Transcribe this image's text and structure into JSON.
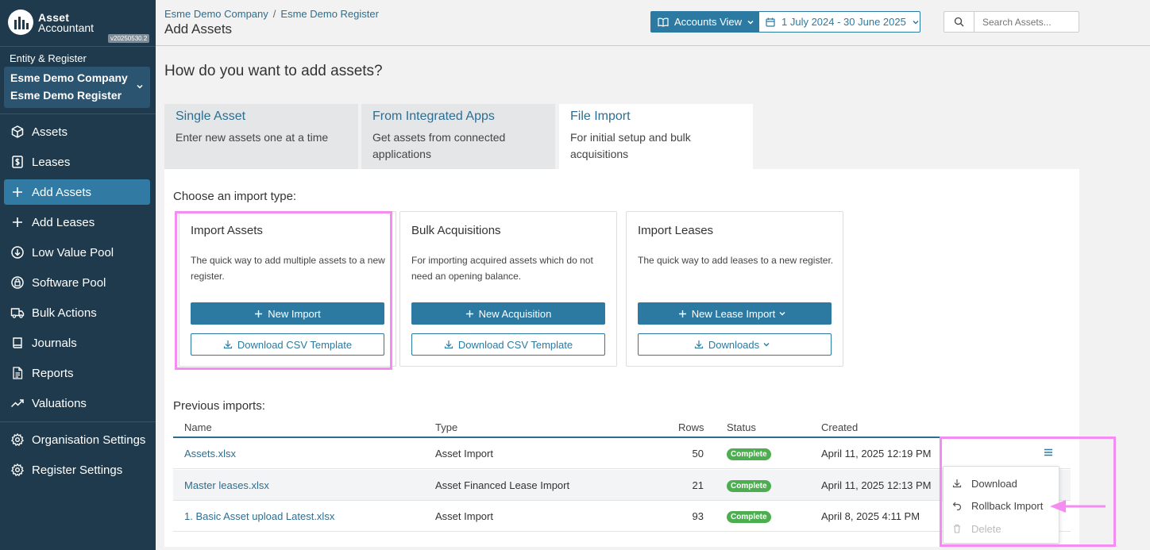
{
  "app": {
    "name_line1": "Asset",
    "name_line2": "Accountant",
    "version": "v20250530.2"
  },
  "sidebar": {
    "entity_label": "Entity & Register",
    "company": "Esme Demo Company",
    "register": "Esme Demo Register",
    "items": [
      {
        "label": "Assets",
        "icon": "cube-icon"
      },
      {
        "label": "Leases",
        "icon": "dollar-doc-icon"
      },
      {
        "label": "Add Assets",
        "icon": "plus-icon",
        "active": true
      },
      {
        "label": "Add Leases",
        "icon": "plus-icon"
      },
      {
        "label": "Low Value Pool",
        "icon": "arrow-circle-icon"
      },
      {
        "label": "Software Pool",
        "icon": "software-icon"
      },
      {
        "label": "Bulk Actions",
        "icon": "truck-icon"
      },
      {
        "label": "Journals",
        "icon": "book-icon"
      },
      {
        "label": "Reports",
        "icon": "report-icon"
      },
      {
        "label": "Valuations",
        "icon": "trend-icon"
      },
      {
        "label": "Organisation Settings",
        "icon": "gear-icon"
      },
      {
        "label": "Register Settings",
        "icon": "gear-icon"
      }
    ]
  },
  "header": {
    "breadcrumb": [
      "Esme Demo Company",
      "Esme Demo Register"
    ],
    "title": "Add Assets",
    "view_label": "Accounts View",
    "date_range": "1 July 2024 - 30 June 2025",
    "search_placeholder": "Search Assets..."
  },
  "main": {
    "question": "How do you want to add assets?",
    "tabs": [
      {
        "title": "Single Asset",
        "desc": "Enter new assets one at a time"
      },
      {
        "title": "From Integrated Apps",
        "desc": "Get assets from connected applications"
      },
      {
        "title": "File Import",
        "desc": "For initial setup and bulk acquisitions",
        "active": true
      }
    ],
    "choose_label": "Choose an import type:",
    "cards": [
      {
        "title": "Import Assets",
        "desc": "The quick way to add multiple assets to a new register.",
        "primary": "New Import",
        "secondary": "Download CSV Template"
      },
      {
        "title": "Bulk Acquisitions",
        "desc": "For importing acquired assets which do not need an opening balance.",
        "primary": "New Acquisition",
        "secondary": "Download CSV Template"
      },
      {
        "title": "Import Leases",
        "desc": "The quick way to add leases to a new register.",
        "primary": "New Lease Import",
        "secondary": "Downloads"
      }
    ],
    "previous_label": "Previous imports:",
    "columns": {
      "name": "Name",
      "type": "Type",
      "rows": "Rows",
      "status": "Status",
      "created": "Created"
    },
    "imports": [
      {
        "name": "Assets.xlsx",
        "type": "Asset Import",
        "rows": "50",
        "status": "Complete",
        "created": "April 11, 2025 12:19 PM"
      },
      {
        "name": "Master leases.xlsx",
        "type": "Asset Financed Lease Import",
        "rows": "21",
        "status": "Complete",
        "created": "April 11, 2025 12:13 PM"
      },
      {
        "name": "1. Basic Asset upload Latest.xlsx",
        "type": "Asset Import",
        "rows": "93",
        "status": "Complete",
        "created": "April 8, 2025 4:11 PM"
      }
    ],
    "row_menu": [
      {
        "label": "Download",
        "icon": "download-icon"
      },
      {
        "label": "Rollback Import",
        "icon": "undo-icon"
      },
      {
        "label": "Delete",
        "icon": "trash-icon",
        "disabled": true
      }
    ]
  },
  "colors": {
    "sidebar": "#1e3a4c",
    "accent": "#2c7aa1",
    "active_nav": "#317aa3",
    "success": "#4cae4f",
    "highlight": "#f58cf2"
  }
}
